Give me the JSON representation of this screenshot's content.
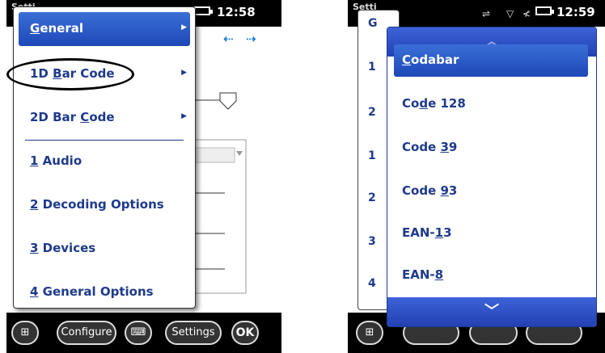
{
  "left": {
    "status": {
      "title": "Setti",
      "time": "12:58"
    },
    "menu": {
      "items": [
        {
          "pre": "",
          "ul": "G",
          "post": "eneral",
          "has_arrow": true,
          "selected": true
        },
        {
          "pre": "1D ",
          "ul": "B",
          "post": "ar Code",
          "has_arrow": true,
          "selected": false
        },
        {
          "pre": "2D Bar ",
          "ul": "C",
          "post": "ode",
          "has_arrow": true,
          "selected": false
        },
        {
          "pre": "",
          "ul": "1",
          "post": " Audio",
          "has_arrow": false,
          "selected": false
        },
        {
          "pre": "",
          "ul": "2",
          "post": " Decoding Options",
          "has_arrow": false,
          "selected": false
        },
        {
          "pre": "",
          "ul": "3",
          "post": " Devices",
          "has_arrow": false,
          "selected": false
        },
        {
          "pre": "",
          "ul": "4",
          "post": " General Options",
          "has_arrow": false,
          "selected": false
        }
      ]
    },
    "softkeys": {
      "configure": "Configure",
      "settings": "Settings",
      "ok": "OK"
    }
  },
  "right": {
    "status": {
      "title": "Setti",
      "time": "12:59"
    },
    "submenu_letters": [
      "G",
      "1",
      "2",
      "1",
      "2",
      "3",
      "4"
    ],
    "picker": {
      "items": [
        {
          "pre": "",
          "ul": "C",
          "post": "odabar",
          "selected": true
        },
        {
          "pre": "Co",
          "ul": "d",
          "post": "e 128",
          "selected": false
        },
        {
          "pre": "Code ",
          "ul": "3",
          "post": "9",
          "selected": false
        },
        {
          "pre": "Code ",
          "ul": "9",
          "post": "3",
          "selected": false
        },
        {
          "pre": "EAN-",
          "ul": "1",
          "post": "3",
          "selected": false
        },
        {
          "pre": "EAN-",
          "ul": "8",
          "post": "",
          "selected": false
        }
      ]
    }
  },
  "icons": {
    "arrow": "right-triangle-icon",
    "nav_left": "arrow-left-icon",
    "nav_right": "arrow-right-icon",
    "scroll_up": "chevron-up-icon",
    "scroll_down": "chevron-down-icon",
    "start": "windows-logo-icon",
    "keyboard": "keyboard-icon"
  },
  "colors": {
    "accent": "#2c55c8",
    "text": "#1e3a8c"
  }
}
